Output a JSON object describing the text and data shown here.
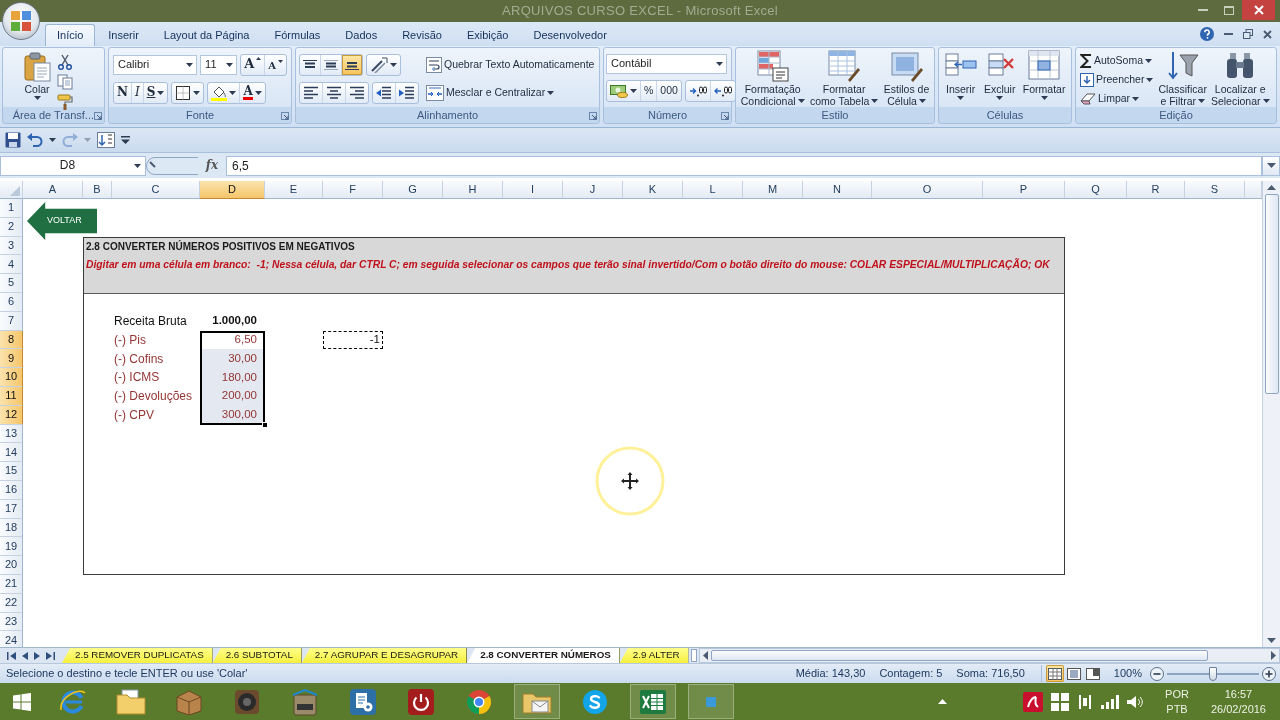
{
  "window": {
    "title": "ARQUIVOS CURSO EXCEL - Microsoft Excel"
  },
  "ribbon_tabs": [
    {
      "label": "Início",
      "selected": true
    },
    {
      "label": "Inserir",
      "selected": false
    },
    {
      "label": "Layout da Página",
      "selected": false
    },
    {
      "label": "Fórmulas",
      "selected": false
    },
    {
      "label": "Dados",
      "selected": false
    },
    {
      "label": "Revisão",
      "selected": false
    },
    {
      "label": "Exibição",
      "selected": false
    },
    {
      "label": "Desenvolvedor",
      "selected": false
    }
  ],
  "ribbon_groups": [
    {
      "label": "Área de Transf...",
      "launcher": true,
      "paste": "Colar"
    },
    {
      "label": "Fonte",
      "launcher": true,
      "font_name": "Calibri",
      "font_size": "11",
      "grow_font": "A",
      "shrink_font": "A",
      "bold": "N",
      "italic": "I",
      "underline": "S",
      "font_color": "A"
    },
    {
      "label": "Alinhamento",
      "launcher": true,
      "vertical_align": [
        {
          "selected": false
        },
        {
          "selected": false
        },
        {
          "selected": true
        }
      ],
      "horizontal_align": [
        {
          "selected": false
        },
        {
          "selected": false
        },
        {
          "selected": false
        }
      ],
      "wrap_text": "Quebrar Texto Automaticamente",
      "merge": "Mesclar e Centralizar"
    },
    {
      "label": "Número",
      "launcher": true,
      "number_format": "Contábil",
      "percent": "%",
      "thousands": "000"
    },
    {
      "label": "Estilo",
      "launcher": false,
      "buttons": [
        [
          "Formatação",
          "Condicional"
        ],
        [
          "Formatar",
          "como Tabela"
        ],
        [
          "Estilos de",
          "Célula"
        ]
      ]
    },
    {
      "label": "Células",
      "launcher": false,
      "buttons": [
        "Inserir",
        "Excluir",
        "Formatar"
      ]
    },
    {
      "label": "Edição",
      "launcher": false,
      "small_buttons": [
        "AutoSoma",
        "Preencher",
        "Limpar"
      ],
      "buttons": [
        [
          "Classificar",
          "e Filtrar"
        ],
        [
          "Localizar e",
          "Selecionar"
        ]
      ]
    }
  ],
  "quick_access_toolbar": [
    {
      "disabled": false
    },
    {
      "disabled": false
    },
    {
      "disabled": true
    },
    {
      "disabled": false
    }
  ],
  "formula_bar": {
    "name_box": "D8",
    "insert_function": "fx",
    "formula": "6,5"
  },
  "columns": [
    {
      "label": "A",
      "selected": false
    },
    {
      "label": "B",
      "selected": false
    },
    {
      "label": "C",
      "selected": false
    },
    {
      "label": "D",
      "selected": true
    },
    {
      "label": "E",
      "selected": false
    },
    {
      "label": "F",
      "selected": false
    },
    {
      "label": "G",
      "selected": false
    },
    {
      "label": "H",
      "selected": false
    },
    {
      "label": "I",
      "selected": false
    },
    {
      "label": "J",
      "selected": false
    },
    {
      "label": "K",
      "selected": false
    },
    {
      "label": "L",
      "selected": false
    },
    {
      "label": "M",
      "selected": false
    },
    {
      "label": "N",
      "selected": false
    },
    {
      "label": "O",
      "selected": false
    },
    {
      "label": "P",
      "selected": false
    },
    {
      "label": "Q",
      "selected": false
    },
    {
      "label": "R",
      "selected": false
    },
    {
      "label": "S",
      "selected": false
    }
  ],
  "rows": [
    {
      "label": "1",
      "selected": false
    },
    {
      "label": "2",
      "selected": false
    },
    {
      "label": "3",
      "selected": false
    },
    {
      "label": "4",
      "selected": false
    },
    {
      "label": "5",
      "selected": false
    },
    {
      "label": "6",
      "selected": false
    },
    {
      "label": "7",
      "selected": false
    },
    {
      "label": "8",
      "selected": true
    },
    {
      "label": "9",
      "selected": true
    },
    {
      "label": "10",
      "selected": true
    },
    {
      "label": "11",
      "selected": true
    },
    {
      "label": "12",
      "selected": true
    },
    {
      "label": "13",
      "selected": false
    },
    {
      "label": "14",
      "selected": false
    },
    {
      "label": "15",
      "selected": false
    },
    {
      "label": "16",
      "selected": false
    },
    {
      "label": "17",
      "selected": false
    },
    {
      "label": "18",
      "selected": false
    },
    {
      "label": "19",
      "selected": false
    },
    {
      "label": "20",
      "selected": false
    },
    {
      "label": "21",
      "selected": false
    },
    {
      "label": "22",
      "selected": false
    },
    {
      "label": "23",
      "selected": false
    },
    {
      "label": "24",
      "selected": false
    }
  ],
  "sheet": {
    "back_button": "VOLTAR",
    "title": "2.8 CONVERTER NÚMEROS POSITIVOS EM NEGATIVOS",
    "instruction": "Digitar em uma célula em branco:  -1; Nessa célula, dar CTRL C; em seguida selecionar os campos que terão sinal invertido/Com o botão direito do mouse: COLAR ESPECIAL/MULTIPLICAÇÃO; OK",
    "table": [
      {
        "kind": "total",
        "label": "Receita Bruta",
        "value": "1.000,00",
        "selected": false,
        "active": false
      },
      {
        "kind": "deduction",
        "label": "(-) Pis",
        "value": "6,50",
        "selected": true,
        "active": true
      },
      {
        "kind": "deduction",
        "label": "(-) Cofins",
        "value": "30,00",
        "selected": true,
        "active": false
      },
      {
        "kind": "deduction",
        "label": "(-) ICMS",
        "value": "180,00",
        "selected": true,
        "active": false
      },
      {
        "kind": "deduction",
        "label": "(-) Devoluções",
        "value": "200,00",
        "selected": true,
        "active": false
      },
      {
        "kind": "deduction",
        "label": "(-) CPV",
        "value": "300,00",
        "selected": true,
        "active": false
      }
    ],
    "copied_cell": "-1"
  },
  "sheet_tabs": [
    {
      "label": "2.5 REMOVER DUPLICATAS",
      "selected": false
    },
    {
      "label": "2.6 SUBTOTAL",
      "selected": false
    },
    {
      "label": "2.7 AGRUPAR E DESAGRUPAR",
      "selected": false
    },
    {
      "label": "2.8 CONVERTER NÚMEROS",
      "selected": true
    },
    {
      "label": "2.9 ALTER",
      "selected": false
    }
  ],
  "status_bar": {
    "message": "Selecione o destino e tecle ENTER ou use 'Colar'",
    "average": "Média: 143,30",
    "count": "Contagem: 5",
    "sum": "Soma: 716,50",
    "views": [
      {
        "selected": true
      },
      {
        "selected": false
      },
      {
        "selected": false
      }
    ],
    "zoom": "100%",
    "zoom_slider": {
      "level": 0.5
    }
  },
  "taskbar": {
    "apps": [
      {
        "active": false
      },
      {
        "active": false
      },
      {
        "active": false
      },
      {
        "active": false
      },
      {
        "active": false
      },
      {
        "active": false
      },
      {
        "active": false
      },
      {
        "active": false
      },
      {
        "active": true
      },
      {
        "active": false
      },
      {
        "active": true
      },
      {
        "active": true
      }
    ],
    "language": "POR",
    "keyboard": "PTB",
    "time": "16:57",
    "date": "26/02/2016"
  }
}
